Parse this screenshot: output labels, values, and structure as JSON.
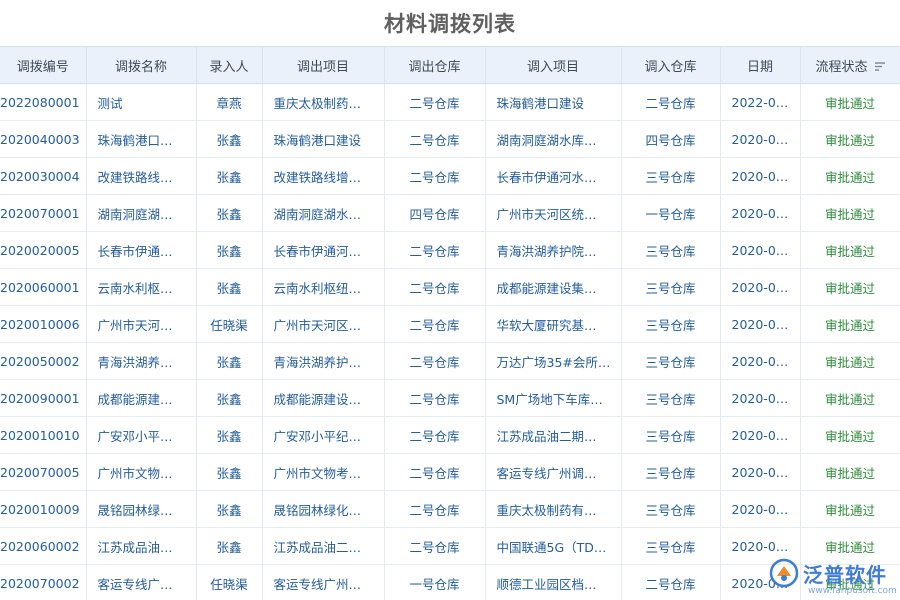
{
  "page": {
    "title": "材料调拨列表"
  },
  "table": {
    "columns": [
      "调拨编号",
      "调拨名称",
      "录入人",
      "调出项目",
      "调出仓库",
      "调入项目",
      "调入仓库",
      "日期",
      "流程状态"
    ],
    "rows": [
      [
        "2022080001",
        "测试",
        "章燕",
        "重庆太极制药…",
        "二号仓库",
        "珠海鹤港口建设",
        "二号仓库",
        "2022-0…",
        "审批通过"
      ],
      [
        "2020040003",
        "珠海鹤港口…",
        "张鑫",
        "珠海鹤港口建设",
        "二号仓库",
        "湖南洞庭湖水库…",
        "四号仓库",
        "2020-0…",
        "审批通过"
      ],
      [
        "2020030004",
        "改建铁路线…",
        "张鑫",
        "改建铁路线增…",
        "二号仓库",
        "长春市伊通河水…",
        "三号仓库",
        "2020-0…",
        "审批通过"
      ],
      [
        "2020070001",
        "湖南洞庭湖…",
        "张鑫",
        "湖南洞庭湖水…",
        "四号仓库",
        "广州市天河区统…",
        "一号仓库",
        "2020-0…",
        "审批通过"
      ],
      [
        "2020020005",
        "长春市伊通…",
        "张鑫",
        "长春市伊通河…",
        "二号仓库",
        "青海洪湖养护院…",
        "三号仓库",
        "2020-0…",
        "审批通过"
      ],
      [
        "2020060001",
        "云南水利枢…",
        "张鑫",
        "云南水利枢纽…",
        "二号仓库",
        "成都能源建设集…",
        "三号仓库",
        "2020-0…",
        "审批通过"
      ],
      [
        "2020010006",
        "广州市天河…",
        "任晓渠",
        "广州市天河区…",
        "二号仓库",
        "华软大厦研究基…",
        "三号仓库",
        "2020-0…",
        "审批通过"
      ],
      [
        "2020050002",
        "青海洪湖养…",
        "张鑫",
        "青海洪湖养护…",
        "二号仓库",
        "万达广场35#会所…",
        "三号仓库",
        "2020-0…",
        "审批通过"
      ],
      [
        "2020090001",
        "成都能源建…",
        "张鑫",
        "成都能源建设…",
        "二号仓库",
        "SM广场地下车库…",
        "三号仓库",
        "2020-0…",
        "审批通过"
      ],
      [
        "2020010010",
        "广安邓小平…",
        "张鑫",
        "广安邓小平纪…",
        "二号仓库",
        "江苏成品油二期…",
        "三号仓库",
        "2020-0…",
        "审批通过"
      ],
      [
        "2020070005",
        "广州市文物…",
        "张鑫",
        "广州市文物考…",
        "二号仓库",
        "客运专线广州调…",
        "三号仓库",
        "2020-0…",
        "审批通过"
      ],
      [
        "2020010009",
        "晟铭园林绿…",
        "张鑫",
        "晟铭园林绿化…",
        "二号仓库",
        "重庆太极制药有…",
        "三号仓库",
        "2020-0…",
        "审批通过"
      ],
      [
        "2020060002",
        "江苏成品油…",
        "张鑫",
        "江苏成品油二…",
        "二号仓库",
        "中国联通5G（TD…",
        "三号仓库",
        "2020-0…",
        "审批通过"
      ],
      [
        "2020070002",
        "客运专线广…",
        "任晓渠",
        "客运专线广州…",
        "一号仓库",
        "顺德工业园区档…",
        "二号仓库",
        "2020-0…",
        "审批通过"
      ]
    ]
  },
  "sort_icon": "sort-filter-icon",
  "colors": {
    "header_bg": "#eaf1fb",
    "link": "#235d9c",
    "status_approved": "#2f8d3c",
    "brand": "#3f7cd6"
  },
  "logo": {
    "icon": "fanpu-logo-icon",
    "name": "泛普软件",
    "url": "www.fanpusoft.com"
  }
}
